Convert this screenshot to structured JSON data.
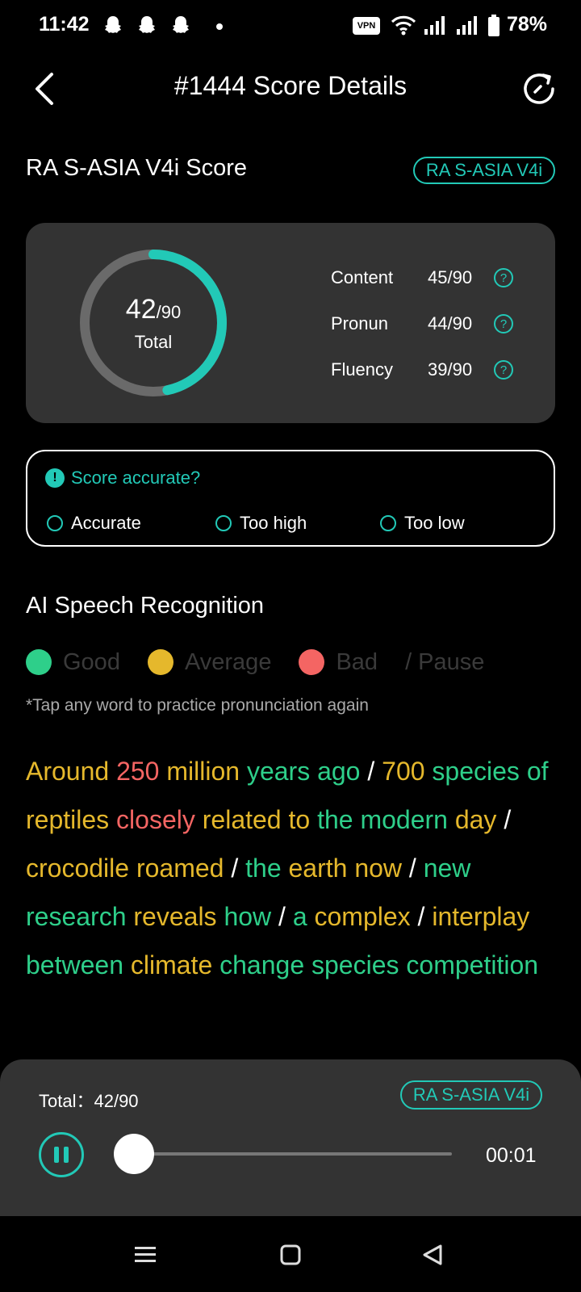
{
  "status_bar": {
    "time": "11:42",
    "vpn": "VPN",
    "battery": "78%"
  },
  "header": {
    "title": "#1444 Score Details"
  },
  "score_section": {
    "title": "RA S-ASIA V4i Score",
    "badge": "RA S-ASIA V4i",
    "total_score": "42",
    "total_max": "/90",
    "total_label": "Total",
    "total_fraction": 0.467,
    "metrics": [
      {
        "name": "Content",
        "value": "45/90"
      },
      {
        "name": "Pronun",
        "value": "44/90"
      },
      {
        "name": "Fluency",
        "value": "39/90"
      }
    ]
  },
  "feedback": {
    "question": "Score accurate?",
    "options": [
      "Accurate",
      "Too high",
      "Too low"
    ]
  },
  "recognition": {
    "title": "AI Speech Recognition",
    "legend": {
      "good": "Good",
      "average": "Average",
      "bad": "Bad",
      "pause": "/ Pause"
    },
    "hint": "*Tap any word to practice pronunciation again",
    "words": [
      {
        "t": "Around",
        "c": "avg"
      },
      {
        "t": "250",
        "c": "bad"
      },
      {
        "t": "million",
        "c": "avg"
      },
      {
        "t": "years",
        "c": "good"
      },
      {
        "t": "ago",
        "c": "good"
      },
      {
        "t": "/",
        "c": "pause"
      },
      {
        "t": "700",
        "c": "avg"
      },
      {
        "t": "species",
        "c": "good"
      },
      {
        "t": "of",
        "c": "good"
      },
      {
        "t": "reptiles",
        "c": "avg"
      },
      {
        "t": "closely",
        "c": "bad"
      },
      {
        "t": "related",
        "c": "avg"
      },
      {
        "t": "to",
        "c": "avg"
      },
      {
        "t": "the",
        "c": "good"
      },
      {
        "t": "modern",
        "c": "good"
      },
      {
        "t": "day",
        "c": "avg"
      },
      {
        "t": "/",
        "c": "pause"
      },
      {
        "t": "crocodile",
        "c": "avg"
      },
      {
        "t": "roamed",
        "c": "avg"
      },
      {
        "t": "/",
        "c": "pause"
      },
      {
        "t": "the",
        "c": "good"
      },
      {
        "t": "earth",
        "c": "avg"
      },
      {
        "t": "now",
        "c": "avg"
      },
      {
        "t": "/",
        "c": "pause"
      },
      {
        "t": "new",
        "c": "good"
      },
      {
        "t": "research",
        "c": "good"
      },
      {
        "t": "reveals",
        "c": "avg"
      },
      {
        "t": "how",
        "c": "good"
      },
      {
        "t": "/",
        "c": "pause"
      },
      {
        "t": "a",
        "c": "good"
      },
      {
        "t": "complex",
        "c": "avg"
      },
      {
        "t": "/",
        "c": "pause"
      },
      {
        "t": "interplay",
        "c": "avg"
      },
      {
        "t": "between",
        "c": "good"
      },
      {
        "t": "climate",
        "c": "avg"
      },
      {
        "t": "change",
        "c": "good"
      },
      {
        "t": "species",
        "c": "good"
      },
      {
        "t": "competition",
        "c": "good"
      }
    ]
  },
  "player": {
    "total_label": "Total：",
    "total_value": "42/90",
    "badge": "RA S-ASIA V4i",
    "time": "00:01",
    "progress": 0.0
  },
  "colors": {
    "accent": "#22c9b7",
    "good": "#2ecf8a",
    "average": "#e5b82c",
    "bad": "#f46563",
    "card": "#333333",
    "ring_track": "#6a6a6a"
  },
  "icons": [
    "back-arrow-icon",
    "refresh-icon",
    "help-icon",
    "info-icon",
    "pause-icon",
    "menu-icon",
    "home-icon",
    "back-triangle-icon",
    "snapchat-ghost-icon",
    "wifi-icon",
    "signal-icon",
    "battery-icon"
  ]
}
